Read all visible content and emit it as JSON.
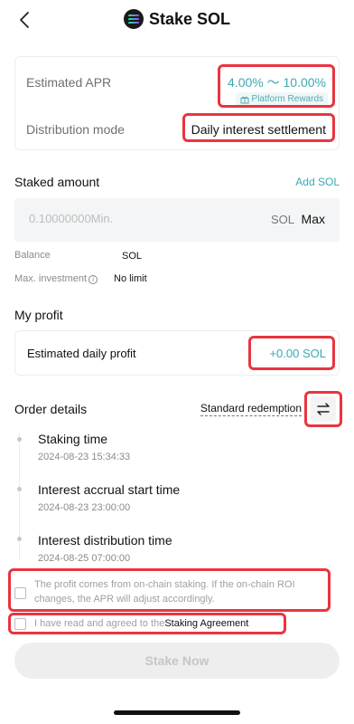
{
  "header": {
    "title": "Stake SOL"
  },
  "summary": {
    "apr_label": "Estimated APR",
    "apr_value": "4.00% ～ 10.00%",
    "rewards_badge": "Platform Rewards",
    "distribution_label": "Distribution mode",
    "distribution_value": "Daily interest settlement"
  },
  "stake": {
    "section_title": "Staked amount",
    "add_link": "Add SOL",
    "input_placeholder": "0.10000000Min.",
    "unit": "SOL",
    "max_label": "Max",
    "balance_label": "Balance",
    "balance_value": "SOL",
    "max_investment_label": "Max. investment",
    "max_investment_value": "No limit"
  },
  "profit": {
    "section_title": "My profit",
    "label": "Estimated daily profit",
    "value": "+0.00 SOL"
  },
  "order": {
    "section_title": "Order details",
    "redemption_label": "Standard redemption",
    "timeline": [
      {
        "title": "Staking time",
        "time": "2024-08-23 15:34:33"
      },
      {
        "title": "Interest accrual start time",
        "time": "2024-08-23 23:00:00"
      },
      {
        "title": "Interest distribution time",
        "time": "2024-08-25 07:00:00"
      }
    ]
  },
  "agreements": {
    "disclaimer": "The profit comes from on-chain staking. If the on-chain ROI changes, the APR will adjust accordingly.",
    "agree_prefix": "I have read and agreed to the",
    "agree_link": "Staking Agreement"
  },
  "actions": {
    "stake_button": "Stake Now"
  },
  "colors": {
    "accent": "#3aa8b5",
    "highlight": "#e8353f",
    "disabled_bg": "#eeeeee"
  },
  "icons": {
    "back": "back-arrow-icon",
    "logo": "solana-logo-icon",
    "gift": "gift-icon",
    "info": "info-icon",
    "swap": "swap-icon"
  }
}
